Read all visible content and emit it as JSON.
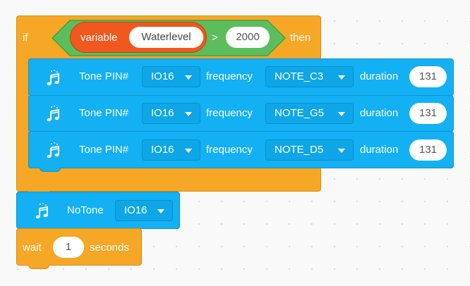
{
  "if_block": {
    "if_label": "if",
    "then_label": "then",
    "condition": {
      "variable_label": "variable",
      "variable_name": "Waterlevel",
      "operator": ">",
      "value": "2000"
    }
  },
  "tone_blocks": [
    {
      "label": "Tone PIN#",
      "pin": "IO16",
      "frequency_label": "frequency",
      "note": "NOTE_C3",
      "duration_label": "duration",
      "duration": "131"
    },
    {
      "label": "Tone PIN#",
      "pin": "IO16",
      "frequency_label": "frequency",
      "note": "NOTE_G5",
      "duration_label": "duration",
      "duration": "131"
    },
    {
      "label": "Tone PIN#",
      "pin": "IO16",
      "frequency_label": "frequency",
      "note": "NOTE_D5",
      "duration_label": "duration",
      "duration": "131"
    }
  ],
  "notone_block": {
    "label": "NoTone",
    "pin": "IO16"
  },
  "wait_block": {
    "wait_label": "wait",
    "value": "1",
    "unit_label": "seconds"
  },
  "colors": {
    "control": "#f7a726",
    "sound": "#13b0f4",
    "variable": "#f0581f",
    "operator": "#5cbd5d"
  },
  "icons": [
    "music-note-icon",
    "dropdown-arrow-icon"
  ]
}
